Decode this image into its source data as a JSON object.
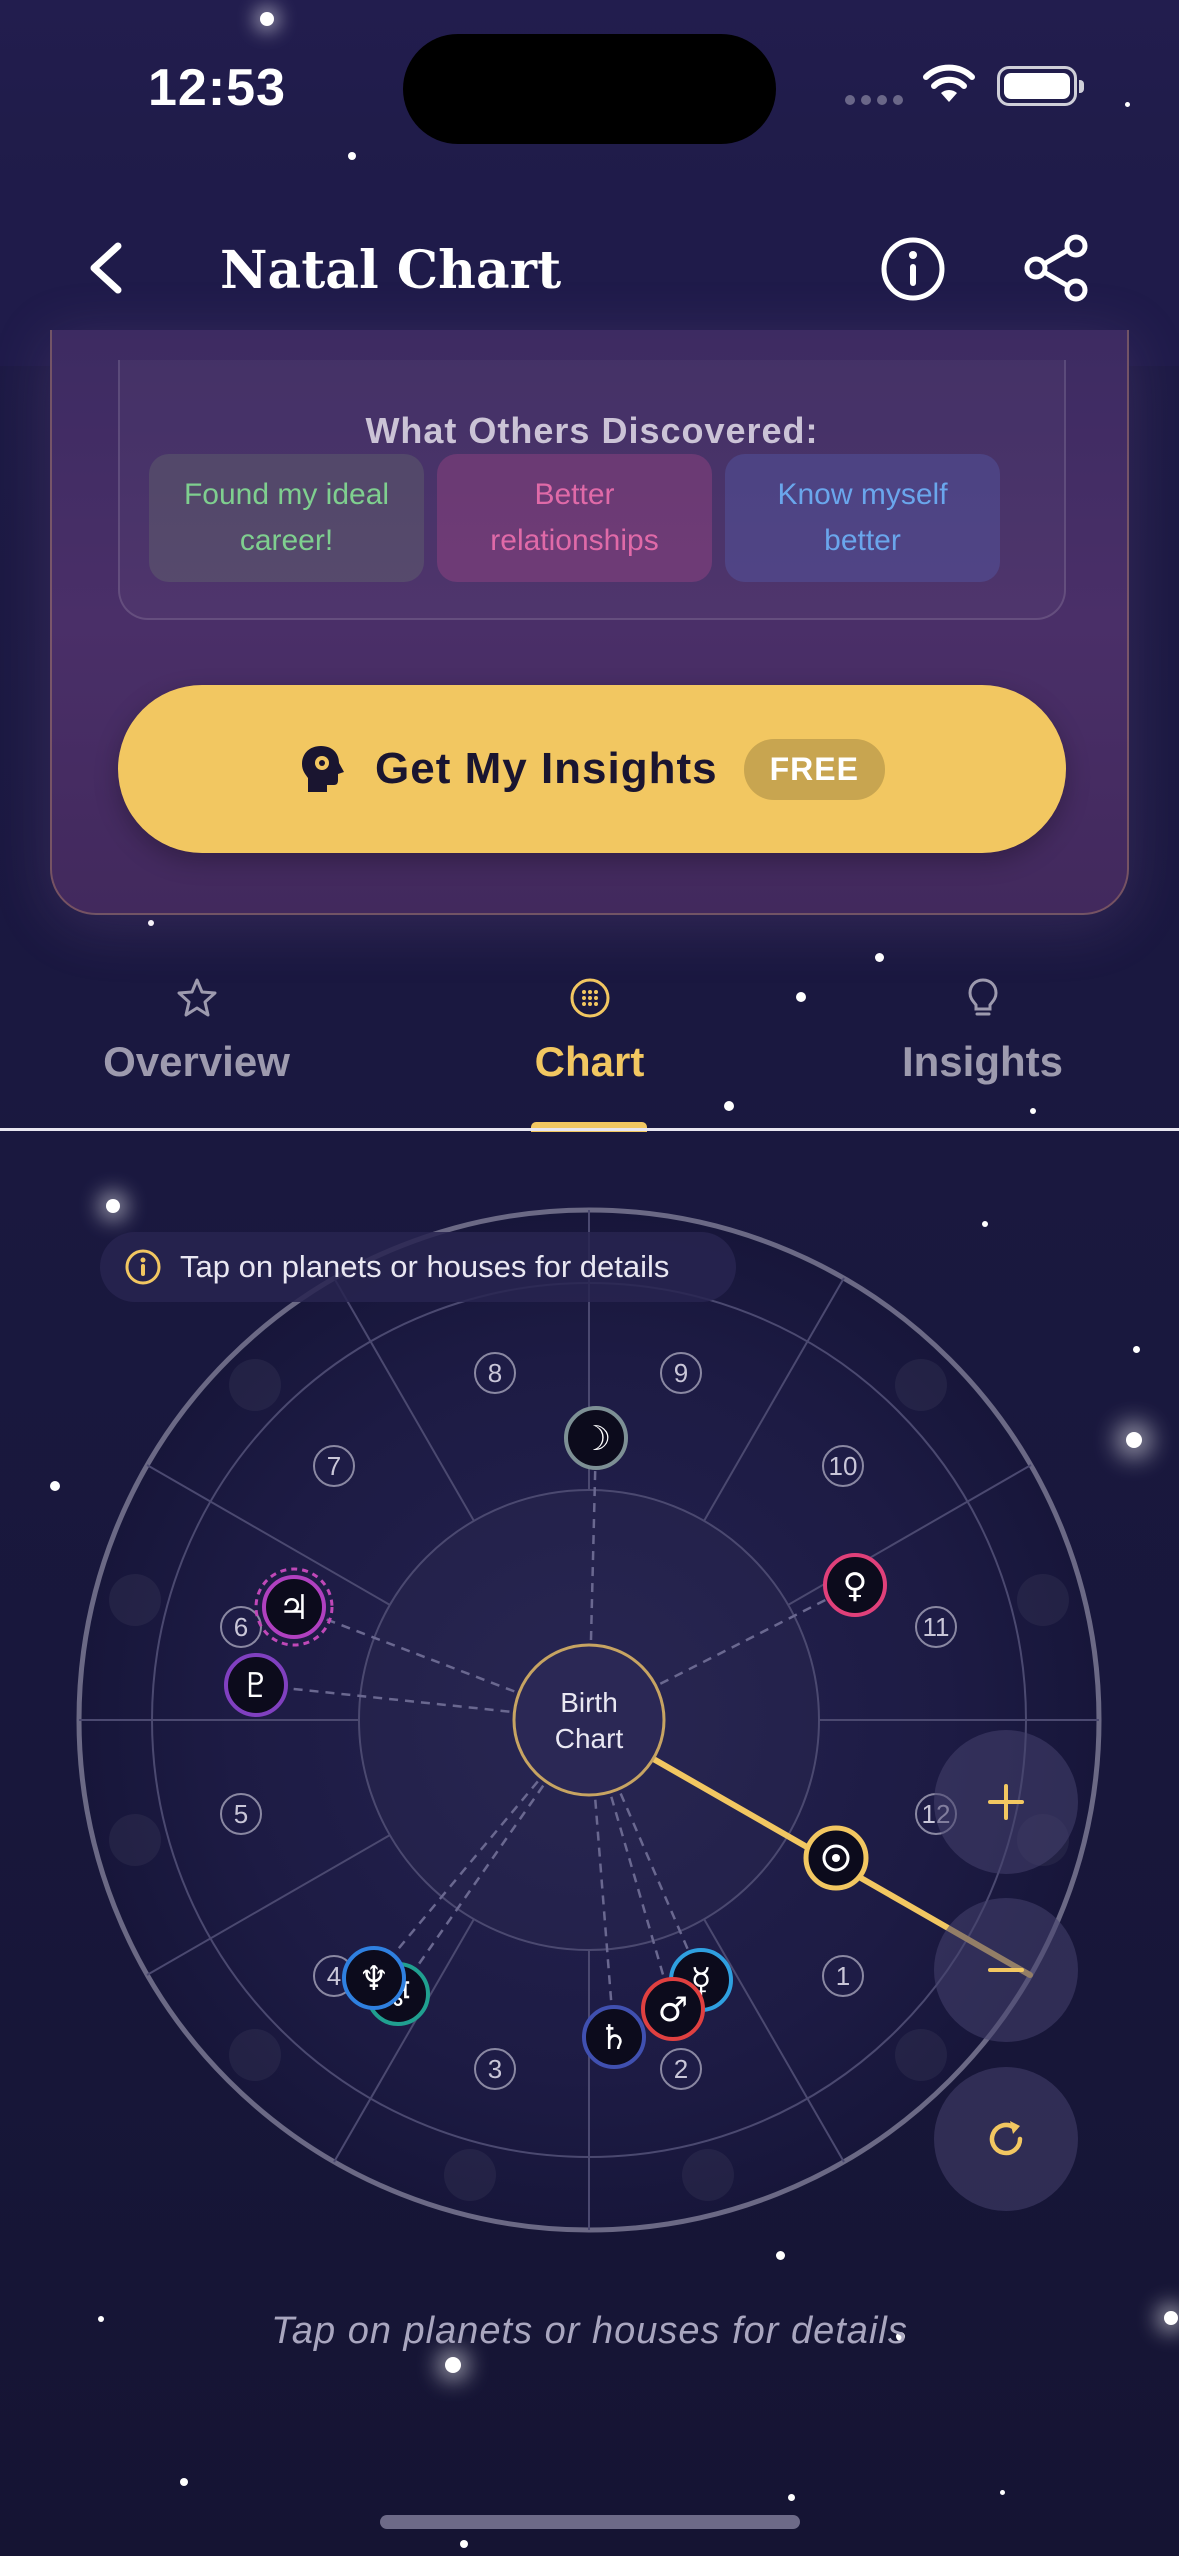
{
  "status_bar": {
    "time": "12:53"
  },
  "nav": {
    "title": "Natal Chart"
  },
  "discover": {
    "title": "What Others Discovered:",
    "chips": [
      "Found my ideal career!",
      "Better relationships",
      "Know myself better"
    ]
  },
  "cta": {
    "label": "Get My Insights",
    "badge": "FREE"
  },
  "tabs": [
    {
      "label": "Overview",
      "icon": "star-icon"
    },
    {
      "label": "Chart",
      "icon": "dotted-circle-icon",
      "active": true
    },
    {
      "label": "Insights",
      "icon": "lightbulb-icon"
    }
  ],
  "chart": {
    "tip": "Tap on planets or houses for details",
    "center_label_line1": "Birth",
    "center_label_line2": "Chart",
    "houses": [
      "1",
      "2",
      "3",
      "4",
      "5",
      "6",
      "7",
      "8",
      "9",
      "10",
      "11",
      "12"
    ],
    "planets": [
      {
        "name": "Moon",
        "symbol": "☽",
        "color": "#8a9aa0"
      },
      {
        "name": "Venus",
        "symbol": "♀",
        "color": "#e0407a"
      },
      {
        "name": "Jupiter",
        "symbol": "♃",
        "color": "#b040c0"
      },
      {
        "name": "Pluto",
        "symbol": "♇",
        "color": "#8040c0"
      },
      {
        "name": "Sun",
        "symbol": "☉",
        "color": "#f2c761"
      },
      {
        "name": "Mercury",
        "symbol": "☿",
        "color": "#2fa0e0"
      },
      {
        "name": "Mars",
        "symbol": "♂",
        "color": "#e04040"
      },
      {
        "name": "Saturn",
        "symbol": "♄",
        "color": "#4050b0"
      },
      {
        "name": "Neptune",
        "symbol": "♆",
        "color": "#2f80e0"
      },
      {
        "name": "Uranus",
        "symbol": "♅",
        "color": "#20a090"
      }
    ]
  },
  "bottom_hint": "Tap on planets or houses for details",
  "colors": {
    "accent": "#f2c761",
    "background": "#1a1840"
  }
}
